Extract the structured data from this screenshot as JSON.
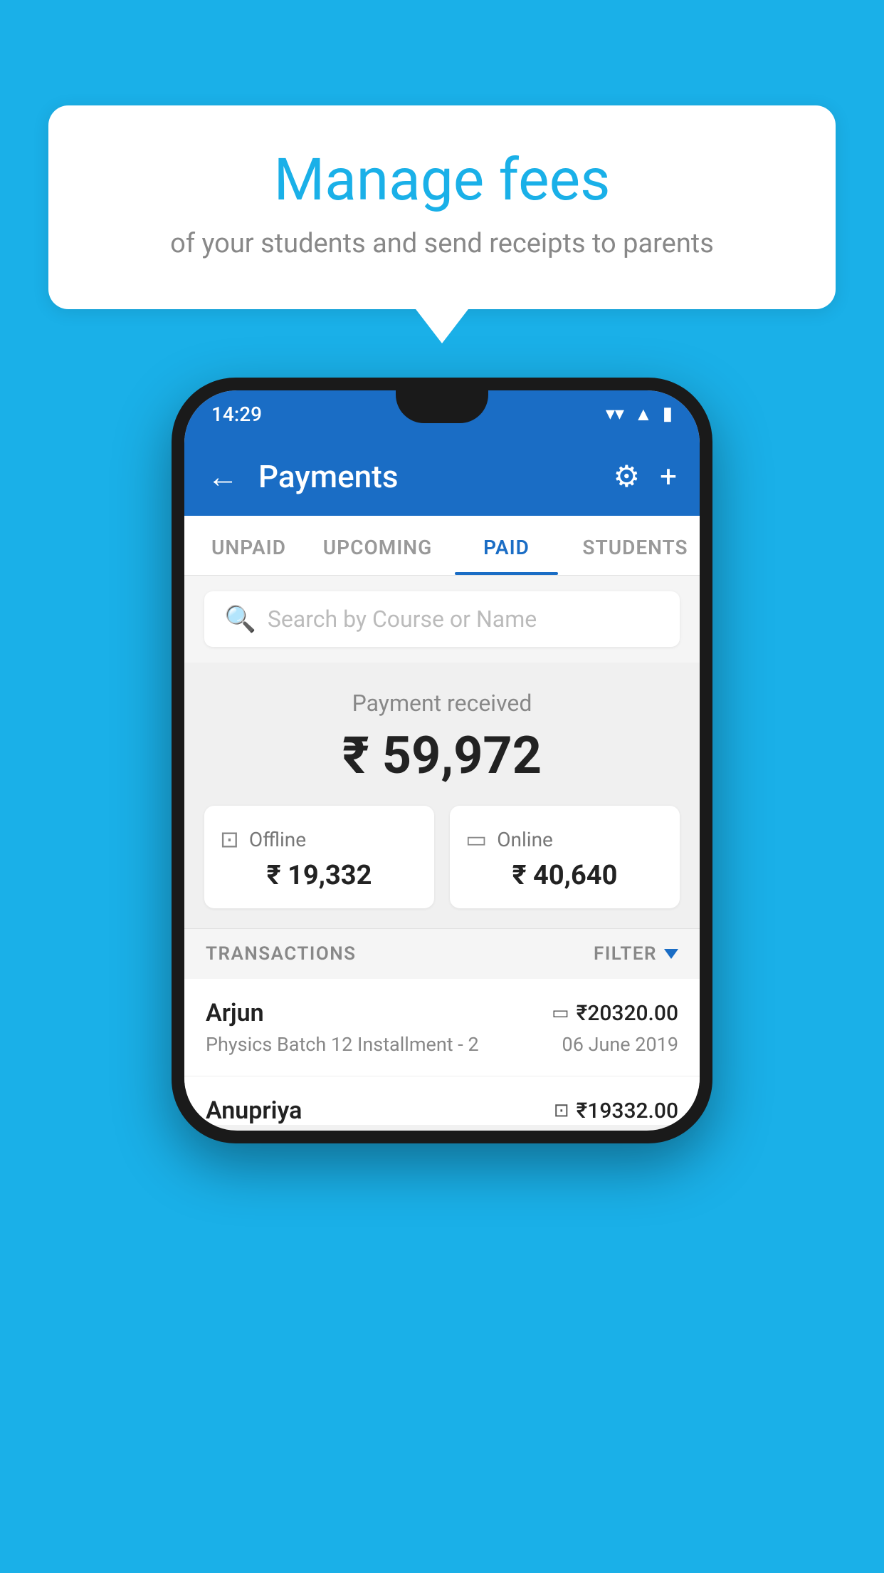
{
  "background_color": "#1ab0e8",
  "speech_bubble": {
    "title": "Manage fees",
    "subtitle": "of your students and send receipts to parents"
  },
  "phone": {
    "status_bar": {
      "time": "14:29",
      "icons": [
        "wifi",
        "signal",
        "battery"
      ]
    },
    "app_bar": {
      "title": "Payments",
      "back_icon": "←",
      "settings_icon": "⚙",
      "add_icon": "+"
    },
    "tabs": [
      {
        "label": "UNPAID",
        "active": false
      },
      {
        "label": "UPCOMING",
        "active": false
      },
      {
        "label": "PAID",
        "active": true
      },
      {
        "label": "STUDENTS",
        "active": false
      }
    ],
    "search": {
      "placeholder": "Search by Course or Name"
    },
    "payment_received": {
      "label": "Payment received",
      "amount": "₹ 59,972",
      "offline": {
        "label": "Offline",
        "amount": "₹ 19,332"
      },
      "online": {
        "label": "Online",
        "amount": "₹ 40,640"
      }
    },
    "transactions_header": {
      "label": "TRANSACTIONS",
      "filter_label": "FILTER"
    },
    "transactions": [
      {
        "name": "Arjun",
        "amount": "₹20320.00",
        "payment_type": "online",
        "course": "Physics Batch 12 Installment - 2",
        "date": "06 June 2019"
      },
      {
        "name": "Anupriya",
        "amount": "₹19332.00",
        "payment_type": "offline",
        "course": "",
        "date": ""
      }
    ]
  }
}
